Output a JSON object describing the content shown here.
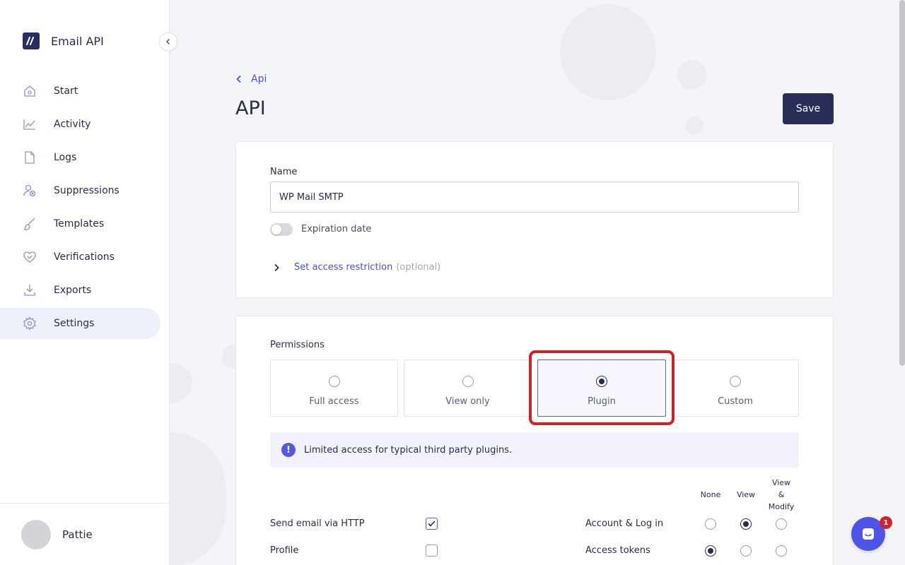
{
  "app": {
    "name": "Email API"
  },
  "sidebar": {
    "items": [
      {
        "label": "Start",
        "icon": "home-icon"
      },
      {
        "label": "Activity",
        "icon": "chart-icon"
      },
      {
        "label": "Logs",
        "icon": "file-icon"
      },
      {
        "label": "Suppressions",
        "icon": "user-block-icon"
      },
      {
        "label": "Templates",
        "icon": "brush-icon"
      },
      {
        "label": "Verifications",
        "icon": "heart-check-icon"
      },
      {
        "label": "Exports",
        "icon": "download-icon"
      },
      {
        "label": "Settings",
        "icon": "gear-icon",
        "active": true
      }
    ],
    "user": {
      "name": "Pattie"
    }
  },
  "header": {
    "breadcrumb": "Api",
    "title": "API",
    "save_label": "Save"
  },
  "form": {
    "name_label": "Name",
    "name_value": "WP Mail SMTP",
    "expiration_label": "Expiration date",
    "expiration_enabled": false,
    "restriction_link": "Set access restriction",
    "restriction_optional": "(optional)"
  },
  "permissions": {
    "label": "Permissions",
    "options": [
      {
        "label": "Full access",
        "selected": false
      },
      {
        "label": "View only",
        "selected": false
      },
      {
        "label": "Plugin",
        "selected": true
      },
      {
        "label": "Custom",
        "selected": false
      }
    ],
    "info": "Limited access for typical third party plugins.",
    "columns": [
      "None",
      "View",
      "View & Modify"
    ],
    "column_lines": [
      "View",
      "&",
      "Modify"
    ],
    "left_rows": [
      {
        "label": "Send email via HTTP",
        "checked": true
      },
      {
        "label": "Profile",
        "checked": false
      }
    ],
    "right_rows": [
      {
        "label": "Account & Log in",
        "value": "View"
      },
      {
        "label": "Access tokens",
        "value": "None"
      }
    ]
  },
  "chat": {
    "badge": "1"
  },
  "colors": {
    "accent": "#4a4fd8",
    "primary_dark": "#2a2d55",
    "highlight": "#d42020"
  }
}
